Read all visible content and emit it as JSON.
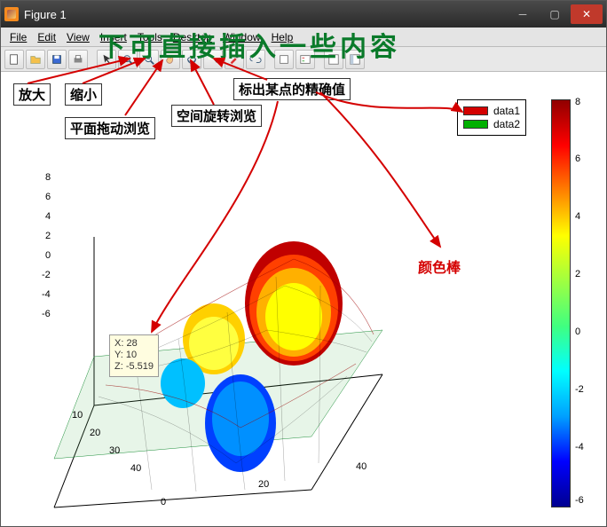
{
  "window": {
    "title": "Figure 1"
  },
  "menu": {
    "file": "File",
    "edit": "Edit",
    "view": "View",
    "insert": "Insert",
    "tools": "Tools",
    "desktop": "Desktop",
    "window": "Window",
    "help": "Help"
  },
  "toolbar": {
    "new": "new",
    "open": "open",
    "save": "save",
    "print": "print",
    "pointer": "pointer",
    "zoomin": "zoom-in",
    "zoomout": "zoom-out",
    "pan": "pan",
    "rotate": "rotate-3d",
    "datacursor": "data-cursor",
    "brush": "brush",
    "link": "link",
    "colorbar": "insert-colorbar",
    "legend": "insert-legend",
    "hide": "hide-tools",
    "dock": "dock"
  },
  "legend": {
    "item1": "data1",
    "item2": "data2",
    "c1": "#d40000",
    "c2": "#00b000"
  },
  "datatip": {
    "x": "X: 28",
    "y": "Y: 10",
    "z": "Z: -5.519"
  },
  "annot": {
    "green_top": "下可直接插入一些内容",
    "zoom_in": "放大",
    "zoom_out": "缩小",
    "pan": "平面拖动浏览",
    "rotate": "空间旋转浏览",
    "datacursor": "标出某点的精确值",
    "colorbar": "颜色棒"
  },
  "colorbar_ticks": [
    "8",
    "6",
    "4",
    "2",
    "0",
    "-2",
    "-4",
    "-6"
  ],
  "z_ticks": [
    "8",
    "6",
    "4",
    "2",
    "0",
    "-2",
    "-4",
    "-6"
  ],
  "x_ticks": [
    "0",
    "20",
    "40"
  ],
  "y_ticks": [
    "10",
    "20",
    "30",
    "40"
  ],
  "chart_data": {
    "type": "surface3d",
    "title": "",
    "description": "MATLAB peaks-like surface (mesh) with overlaid filled surface",
    "series": [
      {
        "name": "data1",
        "style": "mesh",
        "color": "#d40000"
      },
      {
        "name": "data2",
        "style": "surf",
        "colormap": "jet"
      }
    ],
    "x_range": [
      0,
      50
    ],
    "y_range": [
      0,
      50
    ],
    "z_range": [
      -8,
      8
    ],
    "x_ticks": [
      0,
      20,
      40
    ],
    "y_ticks": [
      10,
      20,
      30,
      40
    ],
    "z_ticks": [
      -6,
      -4,
      -2,
      0,
      2,
      4,
      6,
      8
    ],
    "colorbar": {
      "range": [
        -6,
        8
      ],
      "colormap": "jet"
    },
    "sample_points": [
      {
        "x": 28,
        "y": 10,
        "z": -5.519
      },
      {
        "x": 30,
        "y": 18,
        "z": 8.0
      },
      {
        "x": 20,
        "y": 20,
        "z": 2.5
      },
      {
        "x": 25,
        "y": 34,
        "z": -6.0
      }
    ]
  }
}
